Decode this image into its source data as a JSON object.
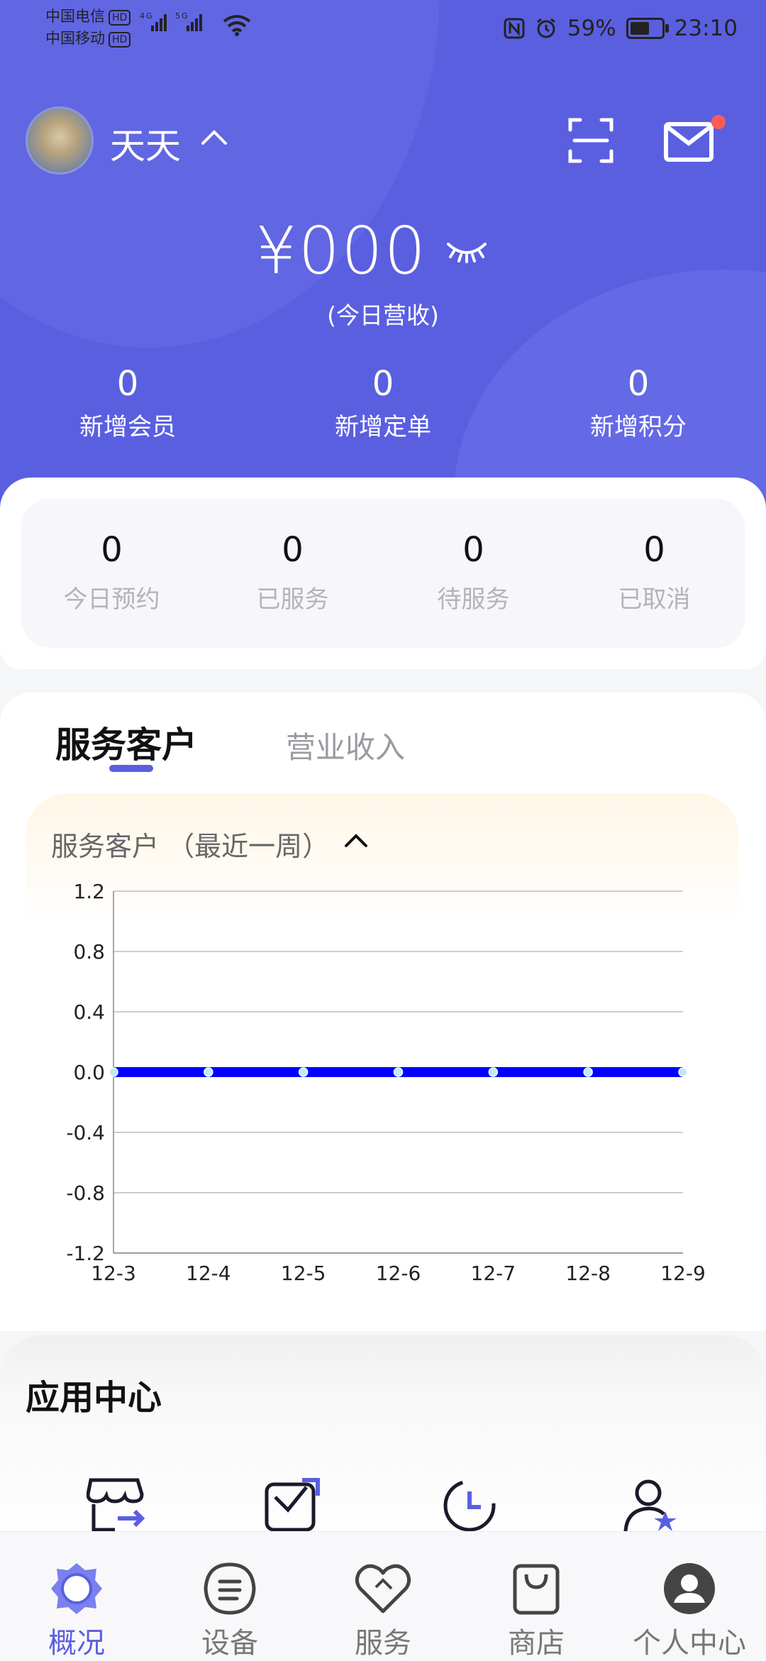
{
  "status_bar": {
    "carrier1": "中国电信",
    "carrier2": "中国移动",
    "hd": "HD",
    "battery": "59%",
    "time": "23:10"
  },
  "header": {
    "username": "天天",
    "revenue": "¥000",
    "revenue_label": "(今日营收)"
  },
  "summary": [
    {
      "value": "0",
      "label": "新增会员"
    },
    {
      "value": "0",
      "label": "新增定单"
    },
    {
      "value": "0",
      "label": "新增积分"
    }
  ],
  "appointments": [
    {
      "value": "0",
      "label": "今日预约"
    },
    {
      "value": "0",
      "label": "已服务"
    },
    {
      "value": "0",
      "label": "待服务"
    },
    {
      "value": "0",
      "label": "已取消"
    }
  ],
  "tabs": [
    {
      "label": "服务客户",
      "active": true
    },
    {
      "label": "营业收入",
      "active": false
    }
  ],
  "chart_section": {
    "title": "服务客户 （最近一周）"
  },
  "chart_data": {
    "type": "line",
    "title": "",
    "x": [
      "12-3",
      "12-4",
      "12-5",
      "12-6",
      "12-7",
      "12-8",
      "12-9"
    ],
    "series": [
      {
        "values": [
          0,
          0,
          0,
          0,
          0,
          0,
          0
        ],
        "color": "#0000ff"
      }
    ],
    "yticks": [
      "1.2",
      "0.8",
      "0.4",
      "0.0",
      "-0.4",
      "-0.8",
      "-1.2"
    ],
    "ylim": [
      -1.2,
      1.2
    ],
    "grid": true
  },
  "app_center": {
    "title": "应用中心",
    "icons": [
      "store-exit-icon",
      "edit-box-icon",
      "clock-icon",
      "user-star-icon"
    ]
  },
  "nav": [
    {
      "label": "概况",
      "icon": "overview-icon",
      "active": true
    },
    {
      "label": "设备",
      "icon": "device-icon",
      "active": false
    },
    {
      "label": "服务",
      "icon": "heart-icon",
      "active": false
    },
    {
      "label": "商店",
      "icon": "shop-bag-icon",
      "active": false
    },
    {
      "label": "个人中心",
      "icon": "profile-icon",
      "active": false
    }
  ],
  "colors": {
    "primary": "#5a5fe0",
    "badge": "#ff5b55",
    "chart_line": "#0000ff"
  }
}
